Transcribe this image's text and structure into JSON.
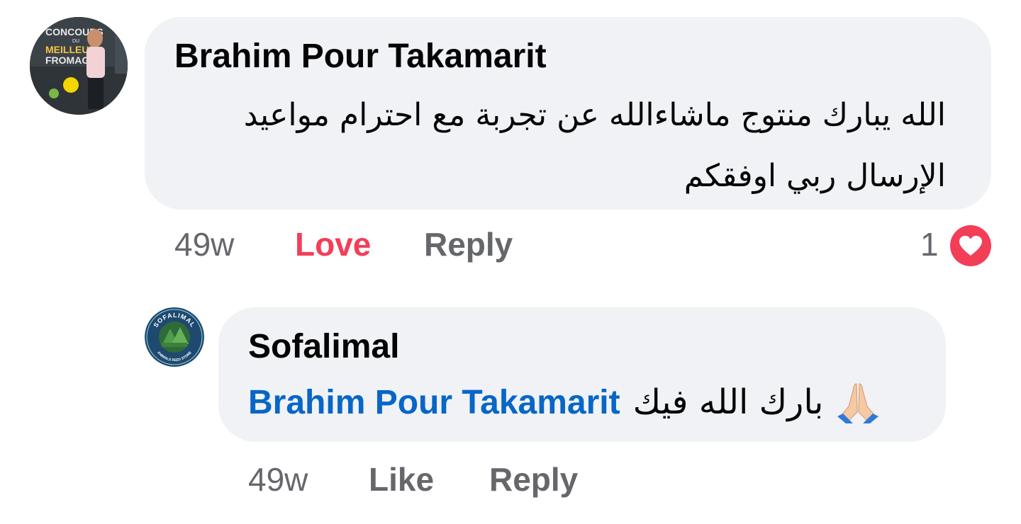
{
  "comment": {
    "author": "Brahim Pour Takamarit",
    "text": "الله يبارك منتوج ماشاءالله عن تجربة مع احترام مواعيد الإرسال ربي اوفقكم",
    "avatar_sign_lines": [
      "CONCOURS",
      "DU",
      "MEILLEUR",
      "FROMAGE"
    ],
    "time": "49w",
    "love_label": "Love",
    "reply_label": "Reply",
    "reaction_count": "1",
    "reaction_icon": "heart-icon",
    "love_color": "#f33e58"
  },
  "reply": {
    "author": "Sofalimal",
    "avatar_logo_top": "SOFALIMAL",
    "avatar_logo_bottom": "ANIMALS FEED STORE",
    "mention": "Brahim Pour Takamarit",
    "text": "بارك الله فيك",
    "emoji": "praying-hands-icon",
    "time": "49w",
    "like_label": "Like",
    "reply_label": "Reply",
    "mention_color": "#0866c6"
  },
  "colors": {
    "bubble": "#f0f2f5",
    "meta_text": "#65676b",
    "primary_text": "#050505"
  }
}
